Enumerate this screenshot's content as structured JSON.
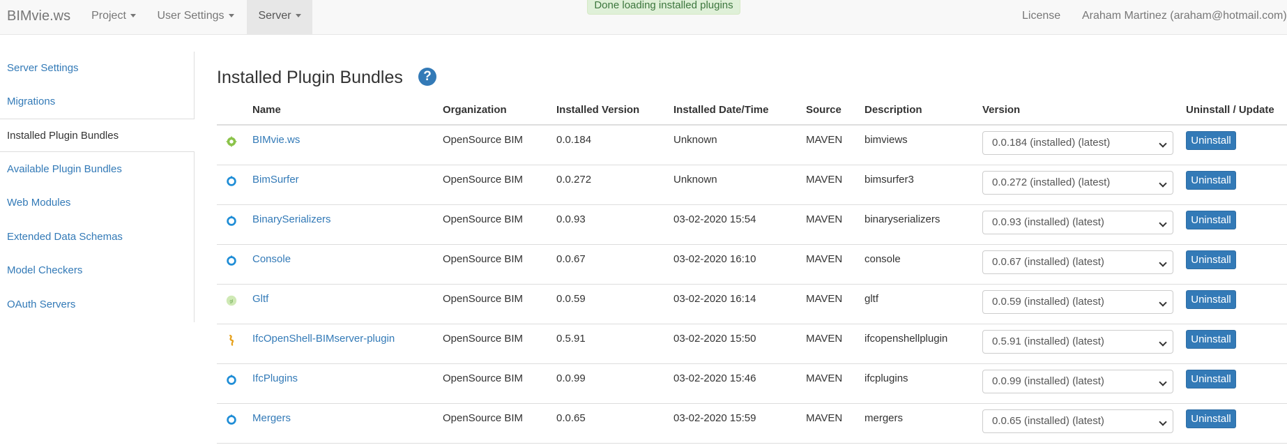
{
  "navbar": {
    "brand": "BIMvie.ws",
    "menus": [
      {
        "label": "Project"
      },
      {
        "label": "User Settings"
      },
      {
        "label": "Server"
      }
    ],
    "license": "License",
    "user": "Araham Martinez (araham@hotmail.com)",
    "alert": "Done loading installed plugins"
  },
  "sidebar": {
    "items": [
      {
        "label": "Server Settings"
      },
      {
        "label": "Migrations"
      },
      {
        "label": "Installed Plugin Bundles"
      },
      {
        "label": "Available Plugin Bundles"
      },
      {
        "label": "Web Modules"
      },
      {
        "label": "Extended Data Schemas"
      },
      {
        "label": "Model Checkers"
      },
      {
        "label": "OAuth Servers"
      }
    ]
  },
  "main": {
    "title": "Installed Plugin Bundles",
    "help_icon": "question-circle-icon",
    "columns": [
      "Name",
      "Organization",
      "Installed Version",
      "Installed Date/Time",
      "Source",
      "Description",
      "Version",
      "Uninstall / Update"
    ],
    "button_label": "Uninstall",
    "rows": [
      {
        "icon": "bimviews-logo-icon",
        "name": "BIMvie.ws",
        "organization": "OpenSource BIM",
        "installed_version": "0.0.184",
        "date": "Unknown",
        "source": "MAVEN",
        "description": "bimviews",
        "version": "0.0.184 (installed) (latest)"
      },
      {
        "icon": "bimserver-logo-icon",
        "name": "BimSurfer",
        "organization": "OpenSource BIM",
        "installed_version": "0.0.272",
        "date": "Unknown",
        "source": "MAVEN",
        "description": "bimsurfer3",
        "version": "0.0.272 (installed) (latest)"
      },
      {
        "icon": "bimserver-logo-icon",
        "name": "BinarySerializers",
        "organization": "OpenSource BIM",
        "installed_version": "0.0.93",
        "date": "03-02-2020 15:54",
        "source": "MAVEN",
        "description": "binaryserializers",
        "version": "0.0.93 (installed) (latest)"
      },
      {
        "icon": "bimserver-logo-icon",
        "name": "Console",
        "organization": "OpenSource BIM",
        "installed_version": "0.0.67",
        "date": "03-02-2020 16:10",
        "source": "MAVEN",
        "description": "console",
        "version": "0.0.67 (installed) (latest)"
      },
      {
        "icon": "gltf-logo-icon",
        "name": "Gltf",
        "organization": "OpenSource BIM",
        "installed_version": "0.0.59",
        "date": "03-02-2020 16:14",
        "source": "MAVEN",
        "description": "gltf",
        "version": "0.0.59 (installed) (latest)"
      },
      {
        "icon": "ifcopenshell-logo-icon",
        "name": "IfcOpenShell-BIMserver-plugin",
        "organization": "OpenSource BIM",
        "installed_version": "0.5.91",
        "date": "03-02-2020 15:50",
        "source": "MAVEN",
        "description": "ifcopenshellplugin",
        "version": "0.5.91 (installed) (latest)"
      },
      {
        "icon": "bimserver-logo-icon",
        "name": "IfcPlugins",
        "organization": "OpenSource BIM",
        "installed_version": "0.0.99",
        "date": "03-02-2020 15:46",
        "source": "MAVEN",
        "description": "ifcplugins",
        "version": "0.0.99 (installed) (latest)"
      },
      {
        "icon": "bimserver-logo-icon",
        "name": "Mergers",
        "organization": "OpenSource BIM",
        "installed_version": "0.0.65",
        "date": "03-02-2020 15:59",
        "source": "MAVEN",
        "description": "mergers",
        "version": "0.0.65 (installed) (latest)"
      }
    ]
  },
  "colors": {
    "link": "#337ab7",
    "primary_button": "#337ab7",
    "alert_bg": "#dff0d8",
    "alert_text": "#3c763d",
    "navbar_bg": "#f8f8f8"
  }
}
